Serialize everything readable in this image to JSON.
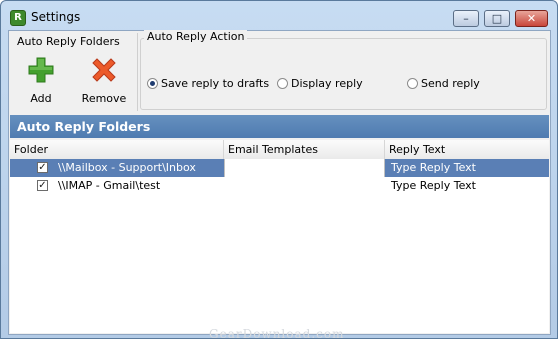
{
  "window": {
    "title": "Settings",
    "controls": {
      "minimize": "–",
      "maximize": "□",
      "close": "✕"
    }
  },
  "toolbar": {
    "folders_group_title": "Auto Reply Folders",
    "add_label": "Add",
    "remove_label": "Remove",
    "action_group_title": "Auto Reply Action",
    "actions": [
      {
        "label": "Save reply to drafts",
        "checked": true
      },
      {
        "label": "Display reply",
        "checked": false
      },
      {
        "label": "Send reply",
        "checked": false
      }
    ]
  },
  "section": {
    "title": "Auto Reply Folders"
  },
  "table": {
    "columns": [
      "Folder",
      "Email Templates",
      "Reply Text"
    ],
    "rows": [
      {
        "checked": true,
        "folder": "\\\\Mailbox - Support\\Inbox",
        "template": "",
        "reply_text": "Type Reply Text",
        "selected": true
      },
      {
        "checked": true,
        "folder": "\\\\IMAP - Gmail\\test",
        "template": "",
        "reply_text": "Type Reply Text",
        "selected": false
      }
    ]
  },
  "watermark": "GearDownload.com",
  "colors": {
    "accent": "#5a7fb5",
    "header": "#4f7bb0",
    "add_icon": "#3f9a2a",
    "remove_icon": "#e8502b"
  },
  "icons": {
    "add": "plus-icon",
    "remove": "x-icon",
    "app": "app-icon"
  }
}
